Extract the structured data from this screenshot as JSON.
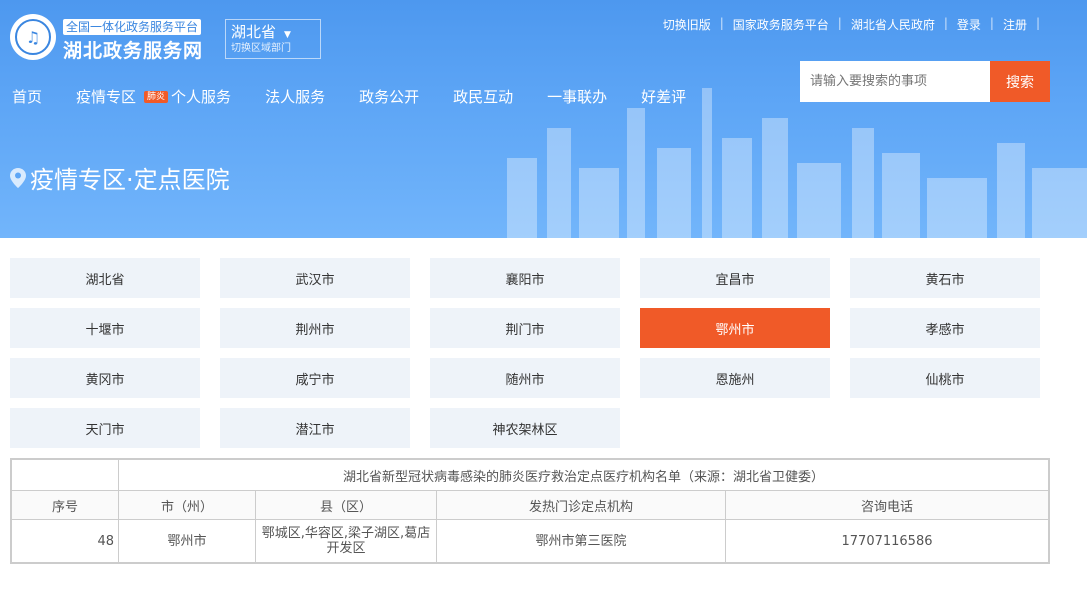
{
  "header": {
    "tagline": "全国一体化政务服务平台",
    "site_name": "湖北政务服务网",
    "region": {
      "name": "湖北省",
      "sub": "切换区域部门"
    },
    "top_links": [
      "切换旧版",
      "国家政务服务平台",
      "湖北省人民政府",
      "登录",
      "注册"
    ],
    "nav": [
      {
        "label": "首页"
      },
      {
        "label": "疫情专区",
        "badge": "肺炎"
      },
      {
        "label": "个人服务"
      },
      {
        "label": "法人服务"
      },
      {
        "label": "政务公开"
      },
      {
        "label": "政民互动"
      },
      {
        "label": "一事联办"
      },
      {
        "label": "好差评"
      }
    ],
    "search": {
      "placeholder": "请输入要搜索的事项",
      "button": "搜索"
    },
    "page_title": "疫情专区·定点医院"
  },
  "cities": [
    "湖北省",
    "武汉市",
    "襄阳市",
    "宜昌市",
    "黄石市",
    "十堰市",
    "荆州市",
    "荆门市",
    "鄂州市",
    "孝感市",
    "黄冈市",
    "咸宁市",
    "随州市",
    "恩施州",
    "仙桃市",
    "天门市",
    "潜江市",
    "神农架林区"
  ],
  "active_city": "鄂州市",
  "colors": {
    "accent": "#f05a28",
    "header_blue": "#5ea6f6",
    "tile_bg": "#eef3f9"
  },
  "table": {
    "caption": "湖北省新型冠状病毒感染的肺炎医疗救治定点医疗机构名单（来源：湖北省卫健委）",
    "headers": [
      "序号",
      "市（州）",
      "县（区）",
      "发热门诊定点机构",
      "咨询电话"
    ],
    "rows": [
      [
        "48",
        "鄂州市",
        "鄂城区,华容区,梁子湖区,葛店开发区",
        "鄂州市第三医院",
        "17707116586"
      ]
    ]
  }
}
